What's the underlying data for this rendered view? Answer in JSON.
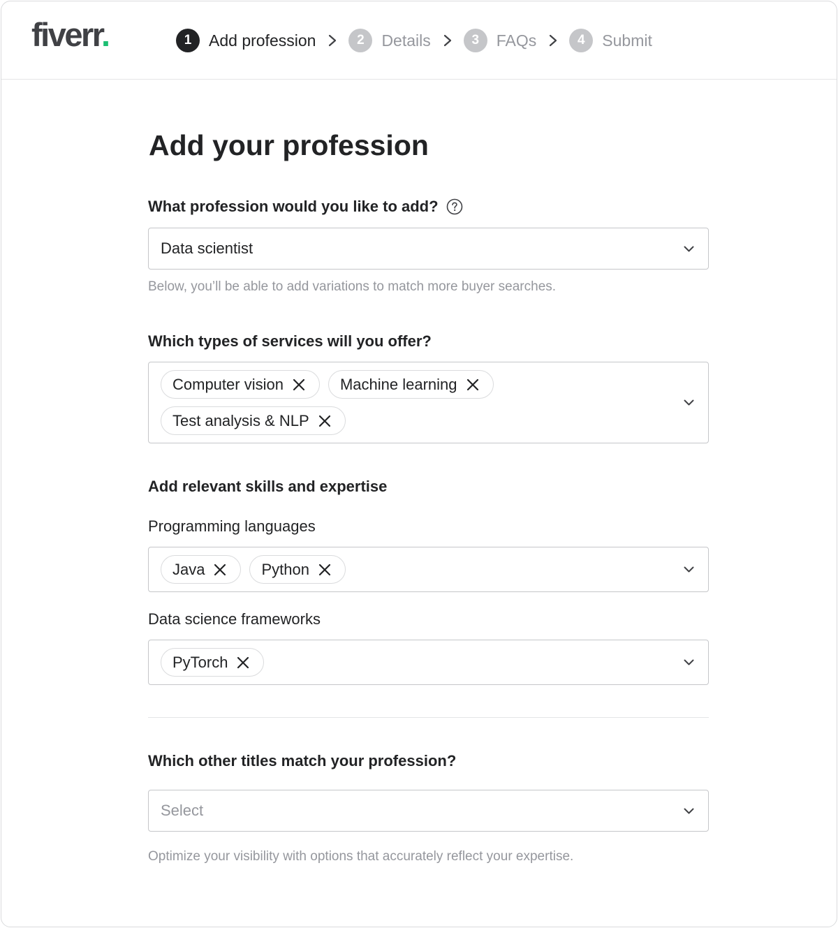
{
  "brand": {
    "logo_text": "fiverr",
    "logo_dot": ".",
    "accent_color": "#1dbf73"
  },
  "steps": [
    {
      "number": "1",
      "label": "Add profession",
      "state": "active"
    },
    {
      "number": "2",
      "label": "Details",
      "state": "inactive"
    },
    {
      "number": "3",
      "label": "FAQs",
      "state": "inactive"
    },
    {
      "number": "4",
      "label": "Submit",
      "state": "inactive"
    }
  ],
  "page": {
    "title": "Add your profession"
  },
  "profession": {
    "label": "What profession would you like to add?",
    "help_icon": "question-circle-icon",
    "value": "Data scientist",
    "hint": "Below, you’ll be able to add variations to match more buyer searches."
  },
  "services": {
    "label": "Which types of services will you offer?",
    "chips": [
      "Computer vision",
      "Machine learning",
      "Test analysis & NLP"
    ]
  },
  "skills": {
    "label": "Add relevant skills and expertise",
    "programming": {
      "label": "Programming languages",
      "chips": [
        "Java",
        "Python"
      ]
    },
    "frameworks": {
      "label": "Data science frameworks",
      "chips": [
        "PyTorch"
      ]
    }
  },
  "titles": {
    "label": "Which other titles match your profession?",
    "placeholder": "Select",
    "hint": "Optimize your visibility with options that accurately reflect your expertise."
  }
}
